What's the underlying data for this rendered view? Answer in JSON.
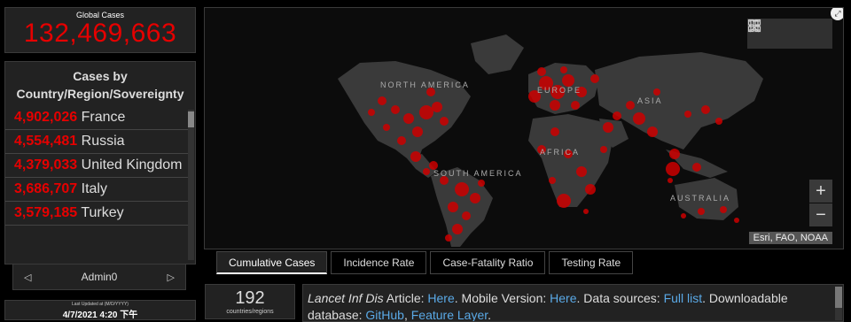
{
  "global": {
    "label": "Global Cases",
    "value": "132,469,663"
  },
  "countries": {
    "title": "Cases by Country/Region/Sovereignty",
    "items": [
      {
        "value": "4,902,026",
        "name": "France"
      },
      {
        "value": "4,554,481",
        "name": "Russia"
      },
      {
        "value": "4,379,033",
        "name": "United Kingdom"
      },
      {
        "value": "3,686,707",
        "name": "Italy"
      },
      {
        "value": "3,579,185",
        "name": "Turkey"
      }
    ]
  },
  "pager": {
    "label": "Admin0",
    "prev": "◁",
    "next": "▷"
  },
  "updated": {
    "label": "Last Updated at (M/D/YYYY)",
    "timestamp": "4/7/2021 4:20 下午"
  },
  "map": {
    "labels": {
      "north_america": "NORTH AMERICA",
      "south_america": "SOUTH AMERICA",
      "europe": "EUROPE",
      "asia": "ASIA",
      "africa": "AFRICA",
      "australia": "AUSTRALIA"
    },
    "attribution": "Esri, FAO, NOAA",
    "zoom_in": "+",
    "zoom_out": "−"
  },
  "tabs": [
    "Cumulative Cases",
    "Incidence Rate",
    "Case-Fatality Ratio",
    "Testing Rate"
  ],
  "count": {
    "value": "192",
    "label": "countries/regions"
  },
  "info": {
    "journal": "Lancet Inf Dis",
    "t1": " Article: ",
    "link1": "Here",
    "t2": ". Mobile Version: ",
    "link2": "Here",
    "t3": ". Data sources: ",
    "link3": "Full list",
    "t4": ". Downloadable database: ",
    "link4": "GitHub",
    "t5": ", ",
    "link5": "Feature Layer",
    "t6": "."
  },
  "colors": {
    "accent_red": "#e60000",
    "link_blue": "#5aa9e6"
  }
}
